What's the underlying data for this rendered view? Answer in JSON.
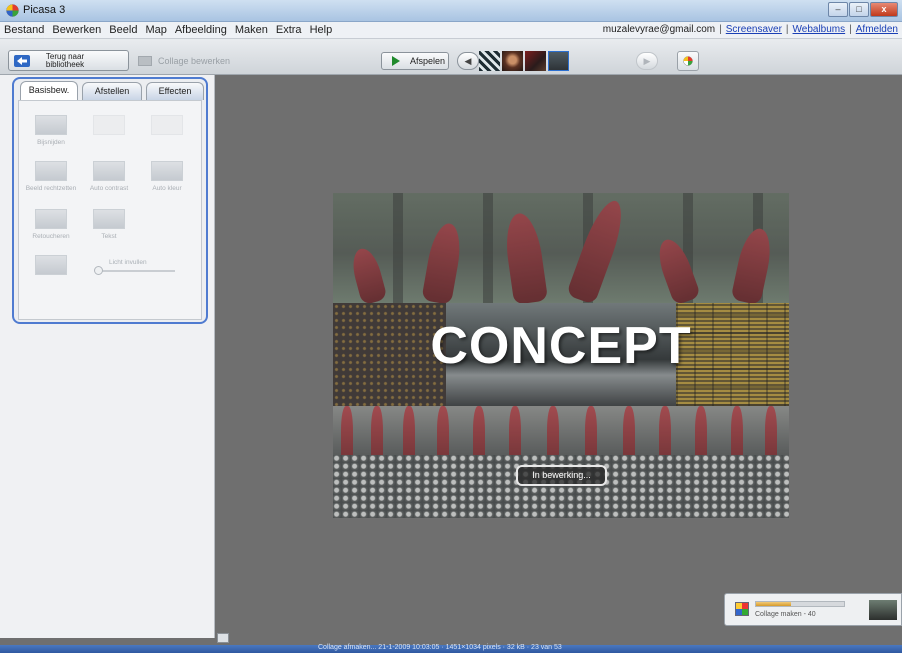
{
  "window": {
    "title": "Picasa 3",
    "controls": [
      "–",
      "□",
      "x"
    ]
  },
  "menu": {
    "items": [
      "Bestand",
      "Bewerken",
      "Beeld",
      "Map",
      "Afbeelding",
      "Maken",
      "Extra",
      "Help"
    ],
    "account_email": "muzalevyrae@gmail.com",
    "links": [
      "Screensaver",
      "Webalbums",
      "Afmelden"
    ]
  },
  "toolbar": {
    "back_label": "Terug naar bibliotheek",
    "collage_label": "Collage bewerken",
    "play_label": "Afspelen"
  },
  "panel": {
    "tabs": [
      "Basisbew.",
      "Afstellen",
      "Effecten"
    ],
    "tools": [
      "Bijsnijden",
      "",
      "",
      "Beeld rechtzetten",
      "Auto contrast",
      "Auto kleur",
      "Retoucheren",
      "Tekst",
      ""
    ],
    "slider_label": "Licht invullen"
  },
  "image": {
    "overlay_text": "CONCEPT",
    "busy_label": "In bewerking..."
  },
  "progress": {
    "label": "Collage maken - 40",
    "fraction": 0.4
  },
  "status": {
    "text": "Collage afmaken... 21-1-2009 10:03:05 · 1451×1034 pixels · 32 kB · 23 van 53"
  }
}
